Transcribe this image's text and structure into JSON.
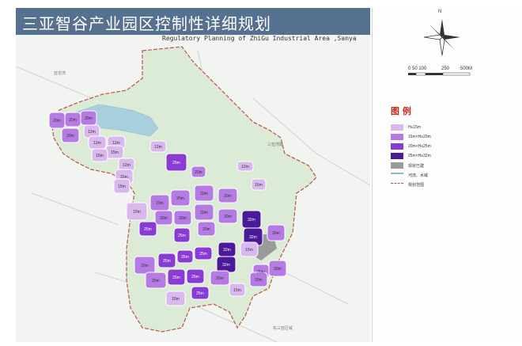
{
  "header": {
    "title": "三亚智谷产业园区控制性详细规划",
    "subtitle": "Regulatory Planning of ZhiGu Industrial Area ,Sanya"
  },
  "north": {
    "label": "N"
  },
  "scale": {
    "ticks": [
      "0 50 100",
      "250",
      "500M"
    ]
  },
  "legend": {
    "title": "图 例",
    "items": [
      {
        "label": "H≤15m",
        "color": "#d9b7ef"
      },
      {
        "label": "15m<H≤20m",
        "color": "#b67ae4"
      },
      {
        "label": "20m<H≤25m",
        "color": "#8a3bd4"
      },
      {
        "label": "25m<H≤32m",
        "color": "#4a1a98"
      },
      {
        "label": "现状已建",
        "color": "#9a9a9a"
      },
      {
        "label": "河流、水域",
        "color": "#88b8c8"
      },
      {
        "label": "规划范围",
        "color": "#e8a0a0"
      }
    ]
  },
  "map": {
    "place_labels": [
      "亚龙湾",
      "三亚湾路",
      "东三亚区域"
    ],
    "height_labels": [
      "20m",
      "20m",
      "20m",
      "12m",
      "20m",
      "12m",
      "12m",
      "15m",
      "15m",
      "12m",
      "12m",
      "15m",
      "25m",
      "15m",
      "20m",
      "12m",
      "15m",
      "15m",
      "20m",
      "20m",
      "20m",
      "20m",
      "20m",
      "25m",
      "20m",
      "25m",
      "20m",
      "32m",
      "20m",
      "20m",
      "32m",
      "20m",
      "32m",
      "15m",
      "20m",
      "25m",
      "25m",
      "25m",
      "32m",
      "20m",
      "25m",
      "25m",
      "20m",
      "20m",
      "25m",
      "15m",
      "15m",
      "20m",
      "20m"
    ]
  },
  "colors": {
    "header_bg": "#56718f",
    "land": "#dcebd6",
    "water": "#a7cfdd",
    "boundary": "#c0504d",
    "h15": "#d9b7ef",
    "h20": "#b67ae4",
    "h25": "#8a3bd4",
    "h32": "#4a1a98",
    "existing": "#9a9a9a"
  }
}
